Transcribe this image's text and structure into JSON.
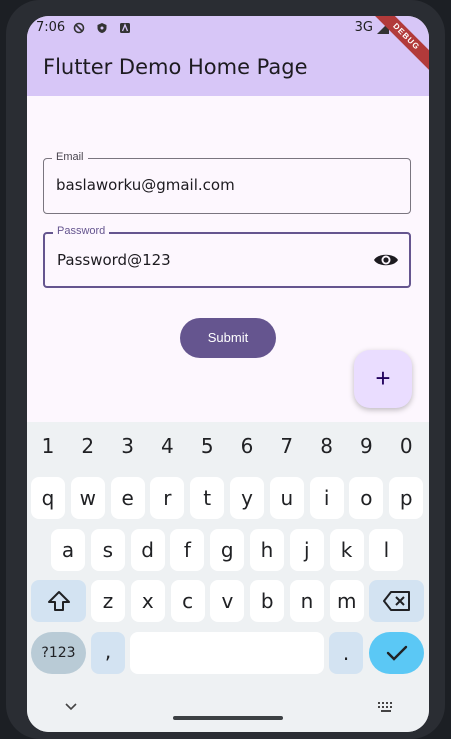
{
  "status": {
    "time": "7:06",
    "network": "3G"
  },
  "appbar": {
    "title": "Flutter Demo Home Page",
    "debug_banner": "DEBUG"
  },
  "form": {
    "email": {
      "label": "Email",
      "value": "baslaworku@gmail.com"
    },
    "password": {
      "label": "Password",
      "value": "Password@123"
    },
    "submit_label": "Submit"
  },
  "fab": {
    "label": "+"
  },
  "keyboard": {
    "digits": [
      "1",
      "2",
      "3",
      "4",
      "5",
      "6",
      "7",
      "8",
      "9",
      "0"
    ],
    "row1": [
      "q",
      "w",
      "e",
      "r",
      "t",
      "y",
      "u",
      "i",
      "o",
      "p"
    ],
    "row2": [
      "a",
      "s",
      "d",
      "f",
      "g",
      "h",
      "j",
      "k",
      "l"
    ],
    "row3": [
      "z",
      "x",
      "c",
      "v",
      "b",
      "n",
      "m"
    ],
    "sym_label": "?123",
    "comma": ",",
    "period": "."
  },
  "colors": {
    "appbar": "#d7c6f7",
    "accent": "#65558f",
    "fab": "#eaddff",
    "enter": "#5bc8f5"
  }
}
